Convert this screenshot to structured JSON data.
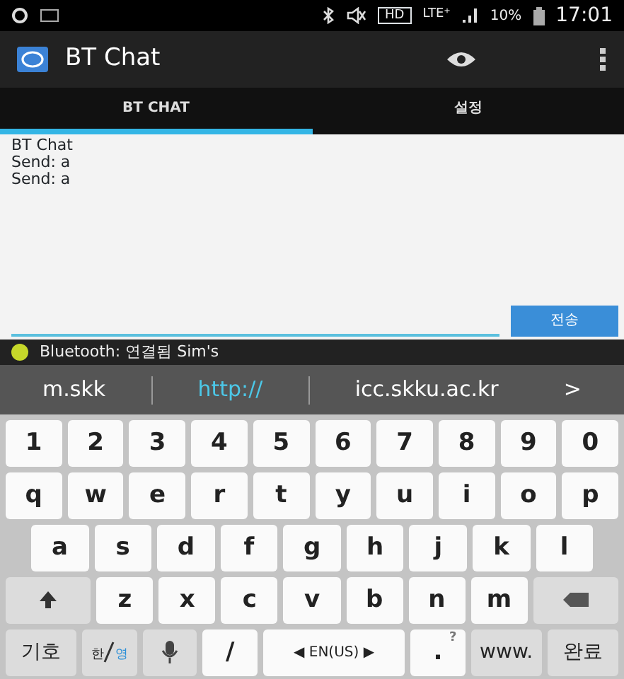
{
  "status_bar": {
    "hd": "HD",
    "network": "LTE⁺",
    "battery": "10%",
    "time": "17:01"
  },
  "app_bar": {
    "title": "BT Chat"
  },
  "tabs": [
    {
      "label": "BT CHAT",
      "selected": true
    },
    {
      "label": "설정",
      "selected": false
    }
  ],
  "chat": {
    "messages": [
      "BT Chat",
      "Send: a",
      "Send: a"
    ]
  },
  "compose": {
    "send_button": "전송"
  },
  "connection": {
    "text": "Bluetooth: 연결됨 Sim's",
    "color": "#c6d82a"
  },
  "suggestions": [
    {
      "text": "m.skk",
      "selected": false
    },
    {
      "text": "http://",
      "selected": true
    },
    {
      "text": "icc.skku.ac.kr",
      "selected": false
    }
  ],
  "suggestion_more": ">",
  "keyboard": [
    [
      {
        "kind": "char",
        "label": "1"
      },
      {
        "kind": "char",
        "label": "2"
      },
      {
        "kind": "char",
        "label": "3"
      },
      {
        "kind": "char",
        "label": "4"
      },
      {
        "kind": "char",
        "label": "5"
      },
      {
        "kind": "char",
        "label": "6"
      },
      {
        "kind": "char",
        "label": "7"
      },
      {
        "kind": "char",
        "label": "8"
      },
      {
        "kind": "char",
        "label": "9"
      },
      {
        "kind": "char",
        "label": "0"
      }
    ],
    [
      {
        "kind": "char",
        "label": "q"
      },
      {
        "kind": "char",
        "label": "w"
      },
      {
        "kind": "char",
        "label": "e"
      },
      {
        "kind": "char",
        "label": "r"
      },
      {
        "kind": "char",
        "label": "t"
      },
      {
        "kind": "char",
        "label": "y"
      },
      {
        "kind": "char",
        "label": "u"
      },
      {
        "kind": "char",
        "label": "i"
      },
      {
        "kind": "char",
        "label": "o"
      },
      {
        "kind": "char",
        "label": "p"
      }
    ],
    [
      {
        "kind": "char",
        "label": "a"
      },
      {
        "kind": "char",
        "label": "s"
      },
      {
        "kind": "char",
        "label": "d"
      },
      {
        "kind": "char",
        "label": "f"
      },
      {
        "kind": "char",
        "label": "g"
      },
      {
        "kind": "char",
        "label": "h"
      },
      {
        "kind": "char",
        "label": "j"
      },
      {
        "kind": "char",
        "label": "k"
      },
      {
        "kind": "char",
        "label": "l"
      }
    ],
    [
      {
        "kind": "shift"
      },
      {
        "kind": "char",
        "label": "z"
      },
      {
        "kind": "char",
        "label": "x"
      },
      {
        "kind": "char",
        "label": "c"
      },
      {
        "kind": "char",
        "label": "v"
      },
      {
        "kind": "char",
        "label": "b"
      },
      {
        "kind": "char",
        "label": "n"
      },
      {
        "kind": "char",
        "label": "m"
      },
      {
        "kind": "backspace"
      }
    ],
    [
      {
        "kind": "special",
        "label": "기호"
      },
      {
        "kind": "lang",
        "label": "한",
        "sub": "영"
      },
      {
        "kind": "mic"
      },
      {
        "kind": "char",
        "label": "/"
      },
      {
        "kind": "space",
        "label": "◀ EN(US) ▶"
      },
      {
        "kind": "char",
        "label": ".",
        "hint": "?"
      },
      {
        "kind": "special",
        "label": "www."
      },
      {
        "kind": "special",
        "label": "완료"
      }
    ]
  ]
}
